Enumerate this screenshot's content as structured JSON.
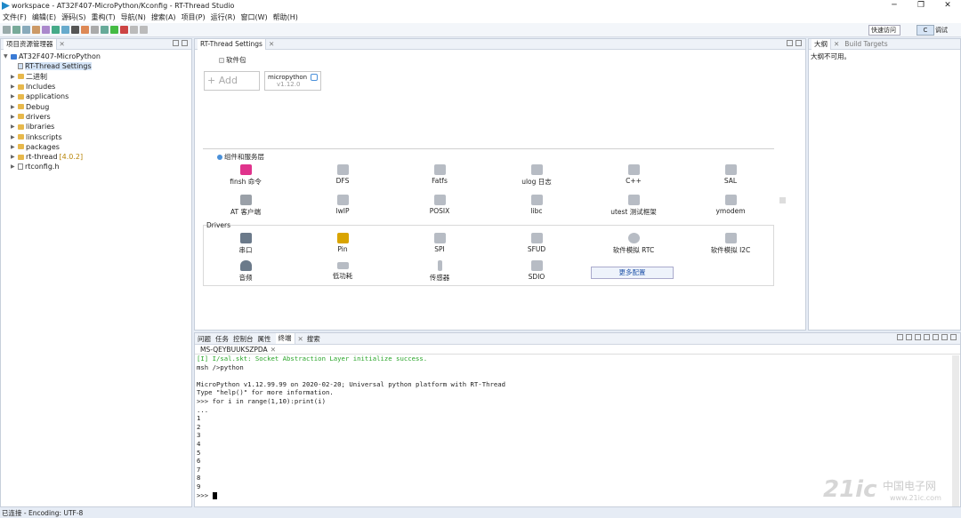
{
  "window": {
    "title": "workspace - AT32F407-MicroPython/Kconfig - RT-Thread Studio",
    "controls": [
      "─",
      "❐",
      "✕"
    ]
  },
  "menu": [
    "文件(F)",
    "编辑(E)",
    "源码(S)",
    "重构(T)",
    "导航(N)",
    "搜索(A)",
    "项目(P)",
    "运行(R)",
    "窗口(W)",
    "帮助(H)"
  ],
  "toolbar": {
    "quick_access": "快速访问",
    "perspective_c": "C",
    "perspective_debug": "调试"
  },
  "project_explorer": {
    "tab": "项目资源管理器",
    "root": "AT32F407-MicroPython",
    "items": [
      {
        "label": "RT-Thread Settings",
        "type": "settings",
        "selected": true
      },
      {
        "label": "二进制",
        "type": "folder"
      },
      {
        "label": "Includes",
        "type": "folder"
      },
      {
        "label": "applications",
        "type": "folder"
      },
      {
        "label": "Debug",
        "type": "folder"
      },
      {
        "label": "drivers",
        "type": "folder"
      },
      {
        "label": "libraries",
        "type": "folder"
      },
      {
        "label": "linkscripts",
        "type": "folder"
      },
      {
        "label": "packages",
        "type": "folder"
      },
      {
        "label": "rt-thread",
        "type": "folder",
        "version": "[4.0.2]"
      },
      {
        "label": "rtconfig.h",
        "type": "file"
      }
    ]
  },
  "settings_editor": {
    "tab": "RT-Thread Settings",
    "packages_title": "软件包",
    "add_label": "+  Add",
    "package": {
      "name": "micropython",
      "version": "v1.12.0"
    },
    "components_title": "组件和服务层",
    "components": [
      "finsh 命令",
      "DFS",
      "Fatfs",
      "ulog 日志",
      "C++",
      "SAL",
      "AT 客户端",
      "lwIP",
      "POSIX",
      "libc",
      "utest 测试框架",
      "ymodem"
    ],
    "drivers_title": "Drivers",
    "drivers": [
      "串口",
      "Pin",
      "SPI",
      "SFUD",
      "软件模拟 RTC",
      "软件模拟 I2C",
      "音频",
      "低功耗",
      "传感器",
      "SDIO"
    ],
    "more_button": "更多配置"
  },
  "outline": {
    "tab": "大纲",
    "tab2": "Build Targets",
    "message": "大纲不可用。"
  },
  "bottom_tabs": [
    "问题",
    "任务",
    "控制台",
    "属性",
    "终端",
    "搜索"
  ],
  "terminal": {
    "session": "MS-QEYBUUKSZPDA",
    "lines": [
      {
        "text": "[I] I/sal.skt: Socket Abstraction Layer initialize success.",
        "color": "green"
      },
      {
        "text": "msh />python"
      },
      {
        "text": ""
      },
      {
        "text": "MicroPython v1.12.99.99 on 2020-02-20; Universal python platform with RT-Thread"
      },
      {
        "text": "Type \"help()\" for more information."
      },
      {
        "text": ">>> for i in range(1,10):print(i)"
      },
      {
        "text": "..."
      },
      {
        "text": "1"
      },
      {
        "text": "2"
      },
      {
        "text": "3"
      },
      {
        "text": "4"
      },
      {
        "text": "5"
      },
      {
        "text": "6"
      },
      {
        "text": "7"
      },
      {
        "text": "8"
      },
      {
        "text": "9"
      }
    ],
    "prompt": ">>> "
  },
  "status": "已连接 - Encoding: UTF-8",
  "watermark": {
    "main": "21ic",
    "cn": "中国电子网",
    "url": "www.21ic.com"
  }
}
